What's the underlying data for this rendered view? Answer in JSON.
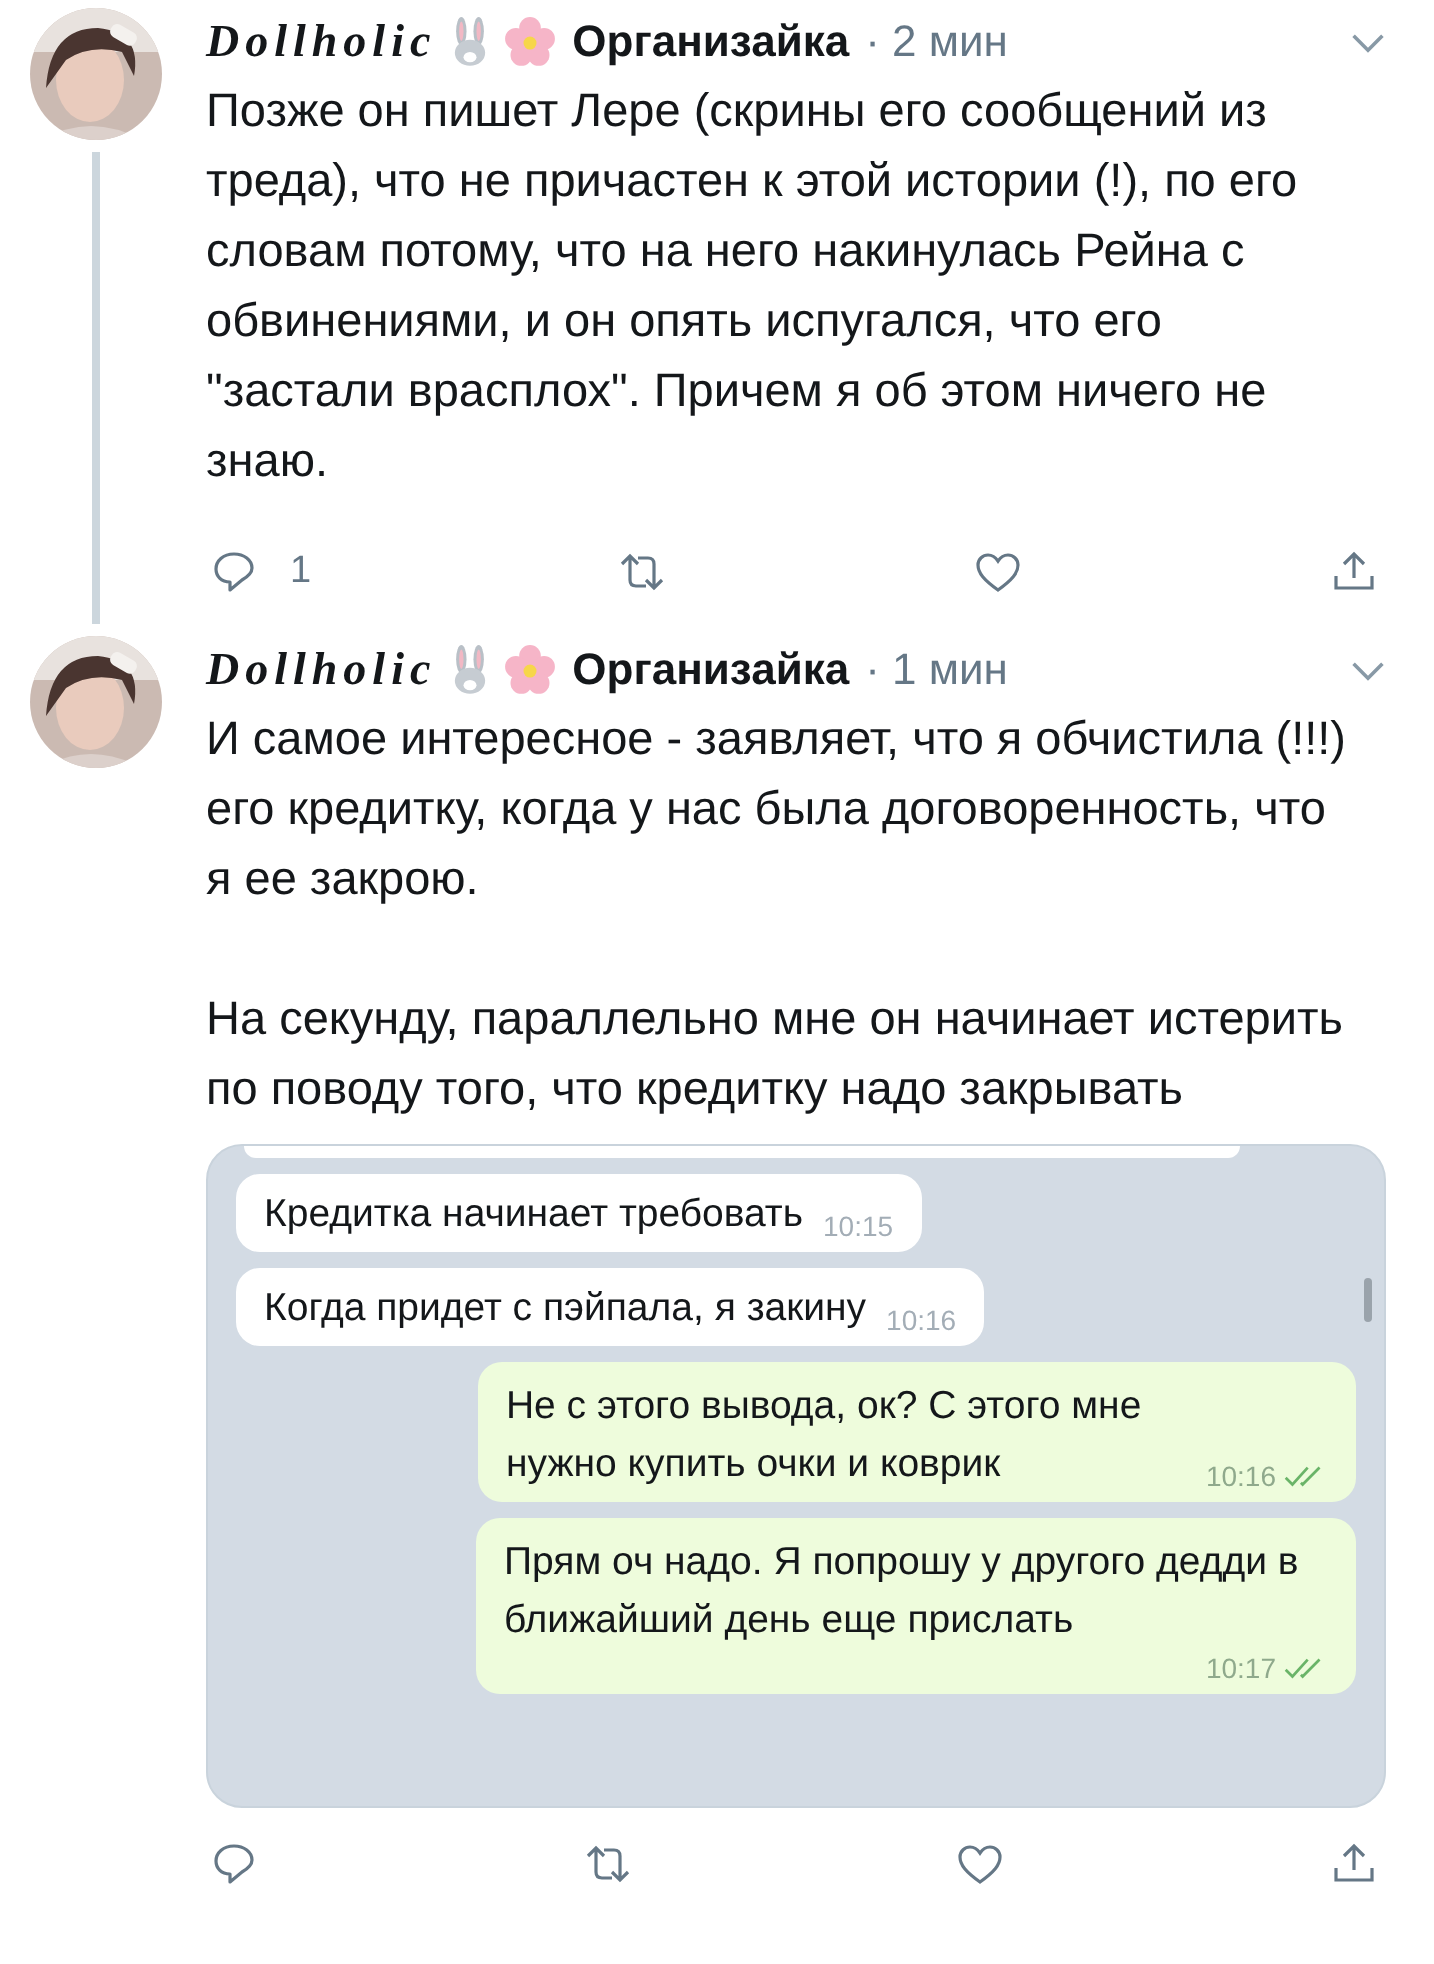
{
  "tweets": [
    {
      "display_name": "Dollholic",
      "handle": "Организайка",
      "time": "· 2 мин",
      "thread_line": true,
      "paragraphs": [
        "Позже он пишет Лере (скрины его сообщений из треда), что не причастен к этой истории (!), по его словам потому, что на него накинулась Рейна с обвинениями, и он опять испугался, что его \"застали врасплох\". Причем я об этом ничего не знаю."
      ],
      "reply_count": "1"
    },
    {
      "display_name": "Dollholic",
      "handle": "Организайка",
      "time": "· 1 мин",
      "thread_line": false,
      "paragraphs": [
        "И самое интересное - заявляет, что я обчистила (!!!) его кредитку, когда у нас была договоренность, что я ее закрою.",
        "На секунду, параллельно мне он начинает истерить по поводу того, что кредитку надо закрывать"
      ],
      "chat": {
        "messages": [
          {
            "kind": "incoming",
            "text": "Кредитка начинает требовать",
            "time": "10:15",
            "read": false
          },
          {
            "kind": "incoming",
            "text": "Когда придет с пэйпала, я закину",
            "time": "10:16",
            "read": false
          },
          {
            "kind": "outgoing",
            "text": "Не с этого вывода, ок? С этого мне нужно купить очки и коврик",
            "time": "10:16",
            "read": true
          },
          {
            "kind": "outgoing",
            "text": "Прям оч надо. Я попрошу у другого дедди в ближайший день еще прислать",
            "time": "10:17",
            "read": true
          }
        ]
      }
    }
  ]
}
